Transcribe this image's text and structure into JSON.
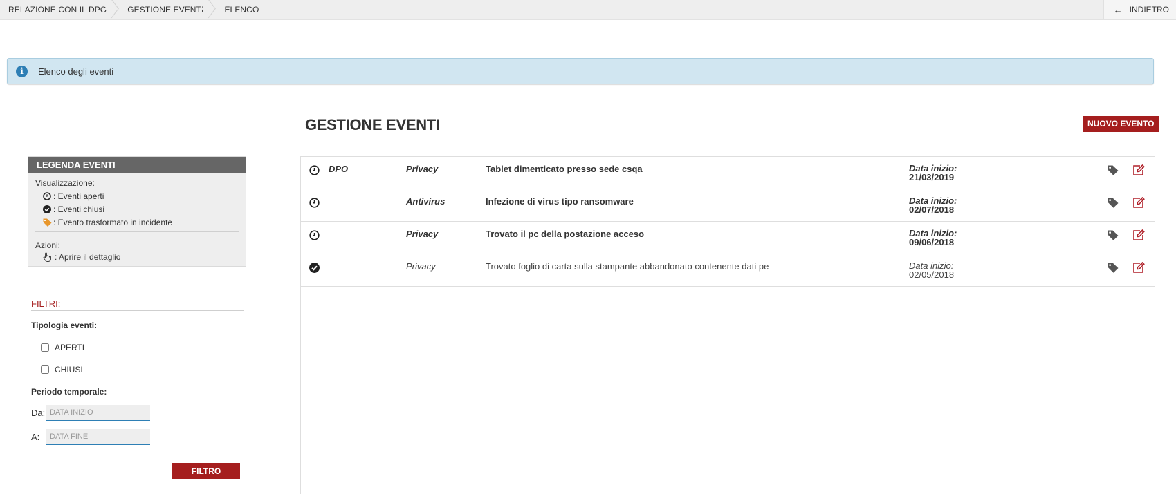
{
  "breadcrumb": {
    "items": [
      "RELAZIONE CON IL DPO",
      "GESTIONE EVENTI",
      "ELENCO"
    ],
    "back_label": "INDIETRO"
  },
  "alert": {
    "text": "Elenco degli eventi"
  },
  "page": {
    "title": "GESTIONE EVENTI",
    "new_button": "NUOVO EVENTO"
  },
  "legend": {
    "title": "LEGENDA EVENTI",
    "visual_label": "Visualizzazione:",
    "items": [
      {
        "icon": "clock-icon",
        "label": ": Eventi aperti"
      },
      {
        "icon": "check-circle-icon",
        "label": ": Eventi chiusi"
      },
      {
        "icon": "tag-icon",
        "label": ": Evento trasformato in incidente"
      }
    ],
    "actions_label": "Azioni:",
    "actions": [
      {
        "icon": "hand-pointer-icon",
        "label": ": Aprire il dettaglio"
      }
    ]
  },
  "filters": {
    "title": "FILTRI:",
    "type_label": "Tipologia eventi:",
    "options": [
      "APERTI",
      "CHIUSI"
    ],
    "period_label": "Periodo temporale:",
    "from_label": "Da:",
    "from_placeholder": "DATA INIZIO",
    "to_label": "A:",
    "to_placeholder": "DATA FINE",
    "button": "FILTRO"
  },
  "events": {
    "date_label": "Data inizio:",
    "rows": [
      {
        "status": "open",
        "owner": "DPO",
        "category": "Privacy",
        "description": "Tablet dimenticato presso sede csqa",
        "date": "21/03/2019"
      },
      {
        "status": "open",
        "owner": "",
        "category": "Antivirus",
        "description": "Infezione di virus tipo ransomware",
        "date": "02/07/2018"
      },
      {
        "status": "open",
        "owner": "",
        "category": "Privacy",
        "description": "Trovato il pc della postazione acceso",
        "date": "09/06/2018"
      },
      {
        "status": "closed",
        "owner": "",
        "category": "Privacy",
        "description": "Trovato foglio di carta sulla stampante abbandonato contenente dati pe",
        "date": "02/05/2018"
      }
    ]
  },
  "colors": {
    "accent": "#a51e1e",
    "info_bg": "#d1e6f1",
    "tag_orange": "#e8962a"
  }
}
